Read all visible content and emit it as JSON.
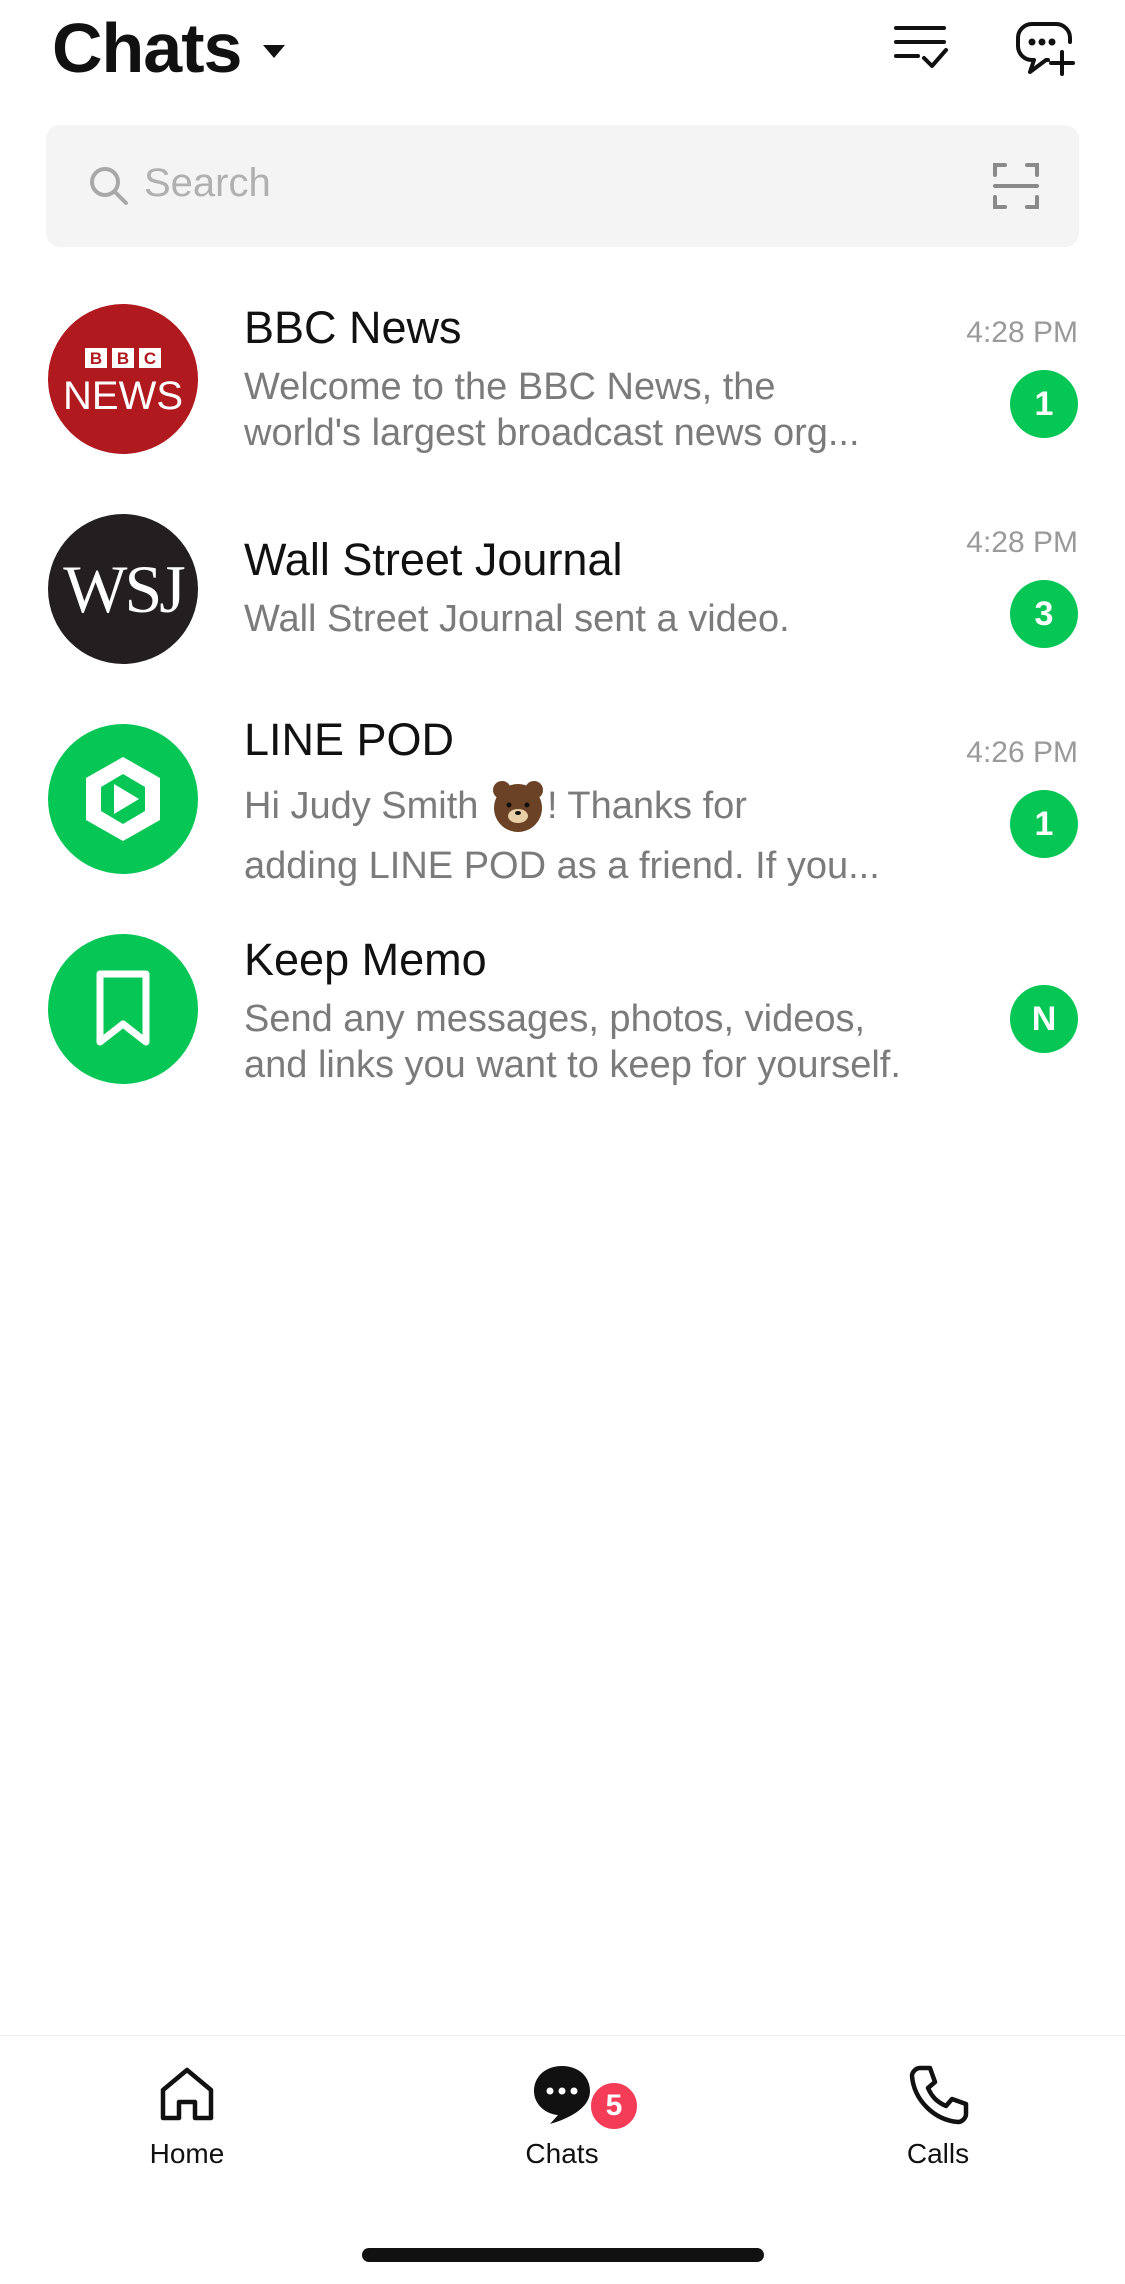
{
  "header": {
    "title": "Chats"
  },
  "search": {
    "placeholder": "Search"
  },
  "chats": [
    {
      "name": "BBC News",
      "preview_lines": [
        "Welcome to the BBC News, the",
        "world's largest broadcast news org..."
      ],
      "time": "4:28 PM",
      "badge": "1",
      "avatar_text_top": "BBC",
      "avatar_text_bottom": "NEWS"
    },
    {
      "name": "Wall Street Journal",
      "preview_lines": [
        "Wall Street Journal sent a video."
      ],
      "time": "4:28 PM",
      "badge": "3",
      "avatar_text": "WSJ"
    },
    {
      "name": "LINE POD",
      "preview_lines": [
        "Hi Judy Smith ",
        "! Thanks for",
        "adding LINE POD as a friend. If you..."
      ],
      "time": "4:26 PM",
      "badge": "1"
    },
    {
      "name": "Keep Memo",
      "preview_lines": [
        "Send any messages, photos, videos,",
        "and links you want to keep for yourself."
      ],
      "badge": "N"
    }
  ],
  "tabbar": {
    "tabs": [
      {
        "label": "Home"
      },
      {
        "label": "Chats",
        "badge": "5"
      },
      {
        "label": "Calls"
      }
    ]
  },
  "colors": {
    "accent_green": "#06c755",
    "badge_red": "#f43c57",
    "bbc_red": "#b0191e",
    "wsj_dark": "#231f20"
  }
}
